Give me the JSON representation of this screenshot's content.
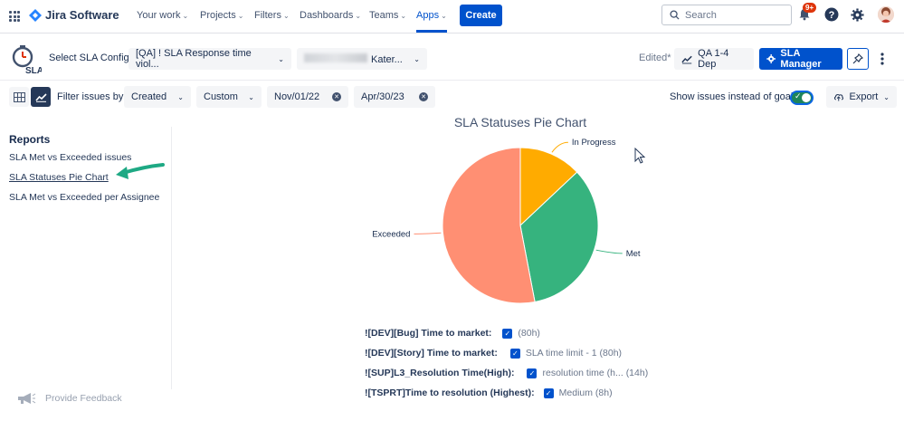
{
  "topnav": {
    "logo": "Jira Software",
    "items": [
      {
        "label": "Your work"
      },
      {
        "label": "Projects"
      },
      {
        "label": "Filters"
      },
      {
        "label": "Dashboards"
      },
      {
        "label": "Teams"
      },
      {
        "label": "Apps"
      }
    ],
    "create_label": "Create",
    "search_placeholder": "Search",
    "notifications_badge": "9+"
  },
  "sla_bar": {
    "select_label": "Select SLA Config:",
    "config_value": "[QA] ! SLA Response time viol...",
    "project_value_suffix": "Kater...",
    "edited": "Edited*",
    "dashboard_button": "QA 1-4 Dep",
    "manager_button": "SLA Manager",
    "logo_text": "SLA"
  },
  "filters": {
    "label": "Filter issues by:",
    "field": "Created",
    "range": "Custom",
    "from": "Nov/01/22",
    "to": "Apr/30/23",
    "toggle_label": "Show issues instead of goals",
    "export_label": "Export"
  },
  "sidebar": {
    "heading": "Reports",
    "reports": [
      "SLA Met vs Exceeded issues",
      "SLA Statuses Pie Chart",
      "SLA Met vs Exceeded per Assignee"
    ],
    "feedback": "Provide Feedback"
  },
  "legend": [
    {
      "name": "![DEV][Bug] Time to market:",
      "goal": "(80h)"
    },
    {
      "name": "![DEV][Story] Time to market:",
      "goal": "SLA time limit - 1 (80h)"
    },
    {
      "name": "![SUP]L3_Resolution Time(High):",
      "goal": "resolution time (h... (14h)"
    },
    {
      "name": "![TSPRT]Time to resolution (Highest):",
      "goal": "Medium (8h)"
    }
  ],
  "colors": {
    "accent": "#0052CC",
    "exceeded": "#FF8F73",
    "met": "#36B37E",
    "in_progress": "#FFAB00"
  },
  "chart_data": {
    "type": "pie",
    "title": "SLA Statuses Pie Chart",
    "slices": [
      {
        "label": "In Progress",
        "value": 13,
        "color": "#FFAB00"
      },
      {
        "label": "Met",
        "value": 34,
        "color": "#36B37E"
      },
      {
        "label": "Exceeded",
        "value": 53,
        "color": "#FF8F73"
      }
    ]
  }
}
